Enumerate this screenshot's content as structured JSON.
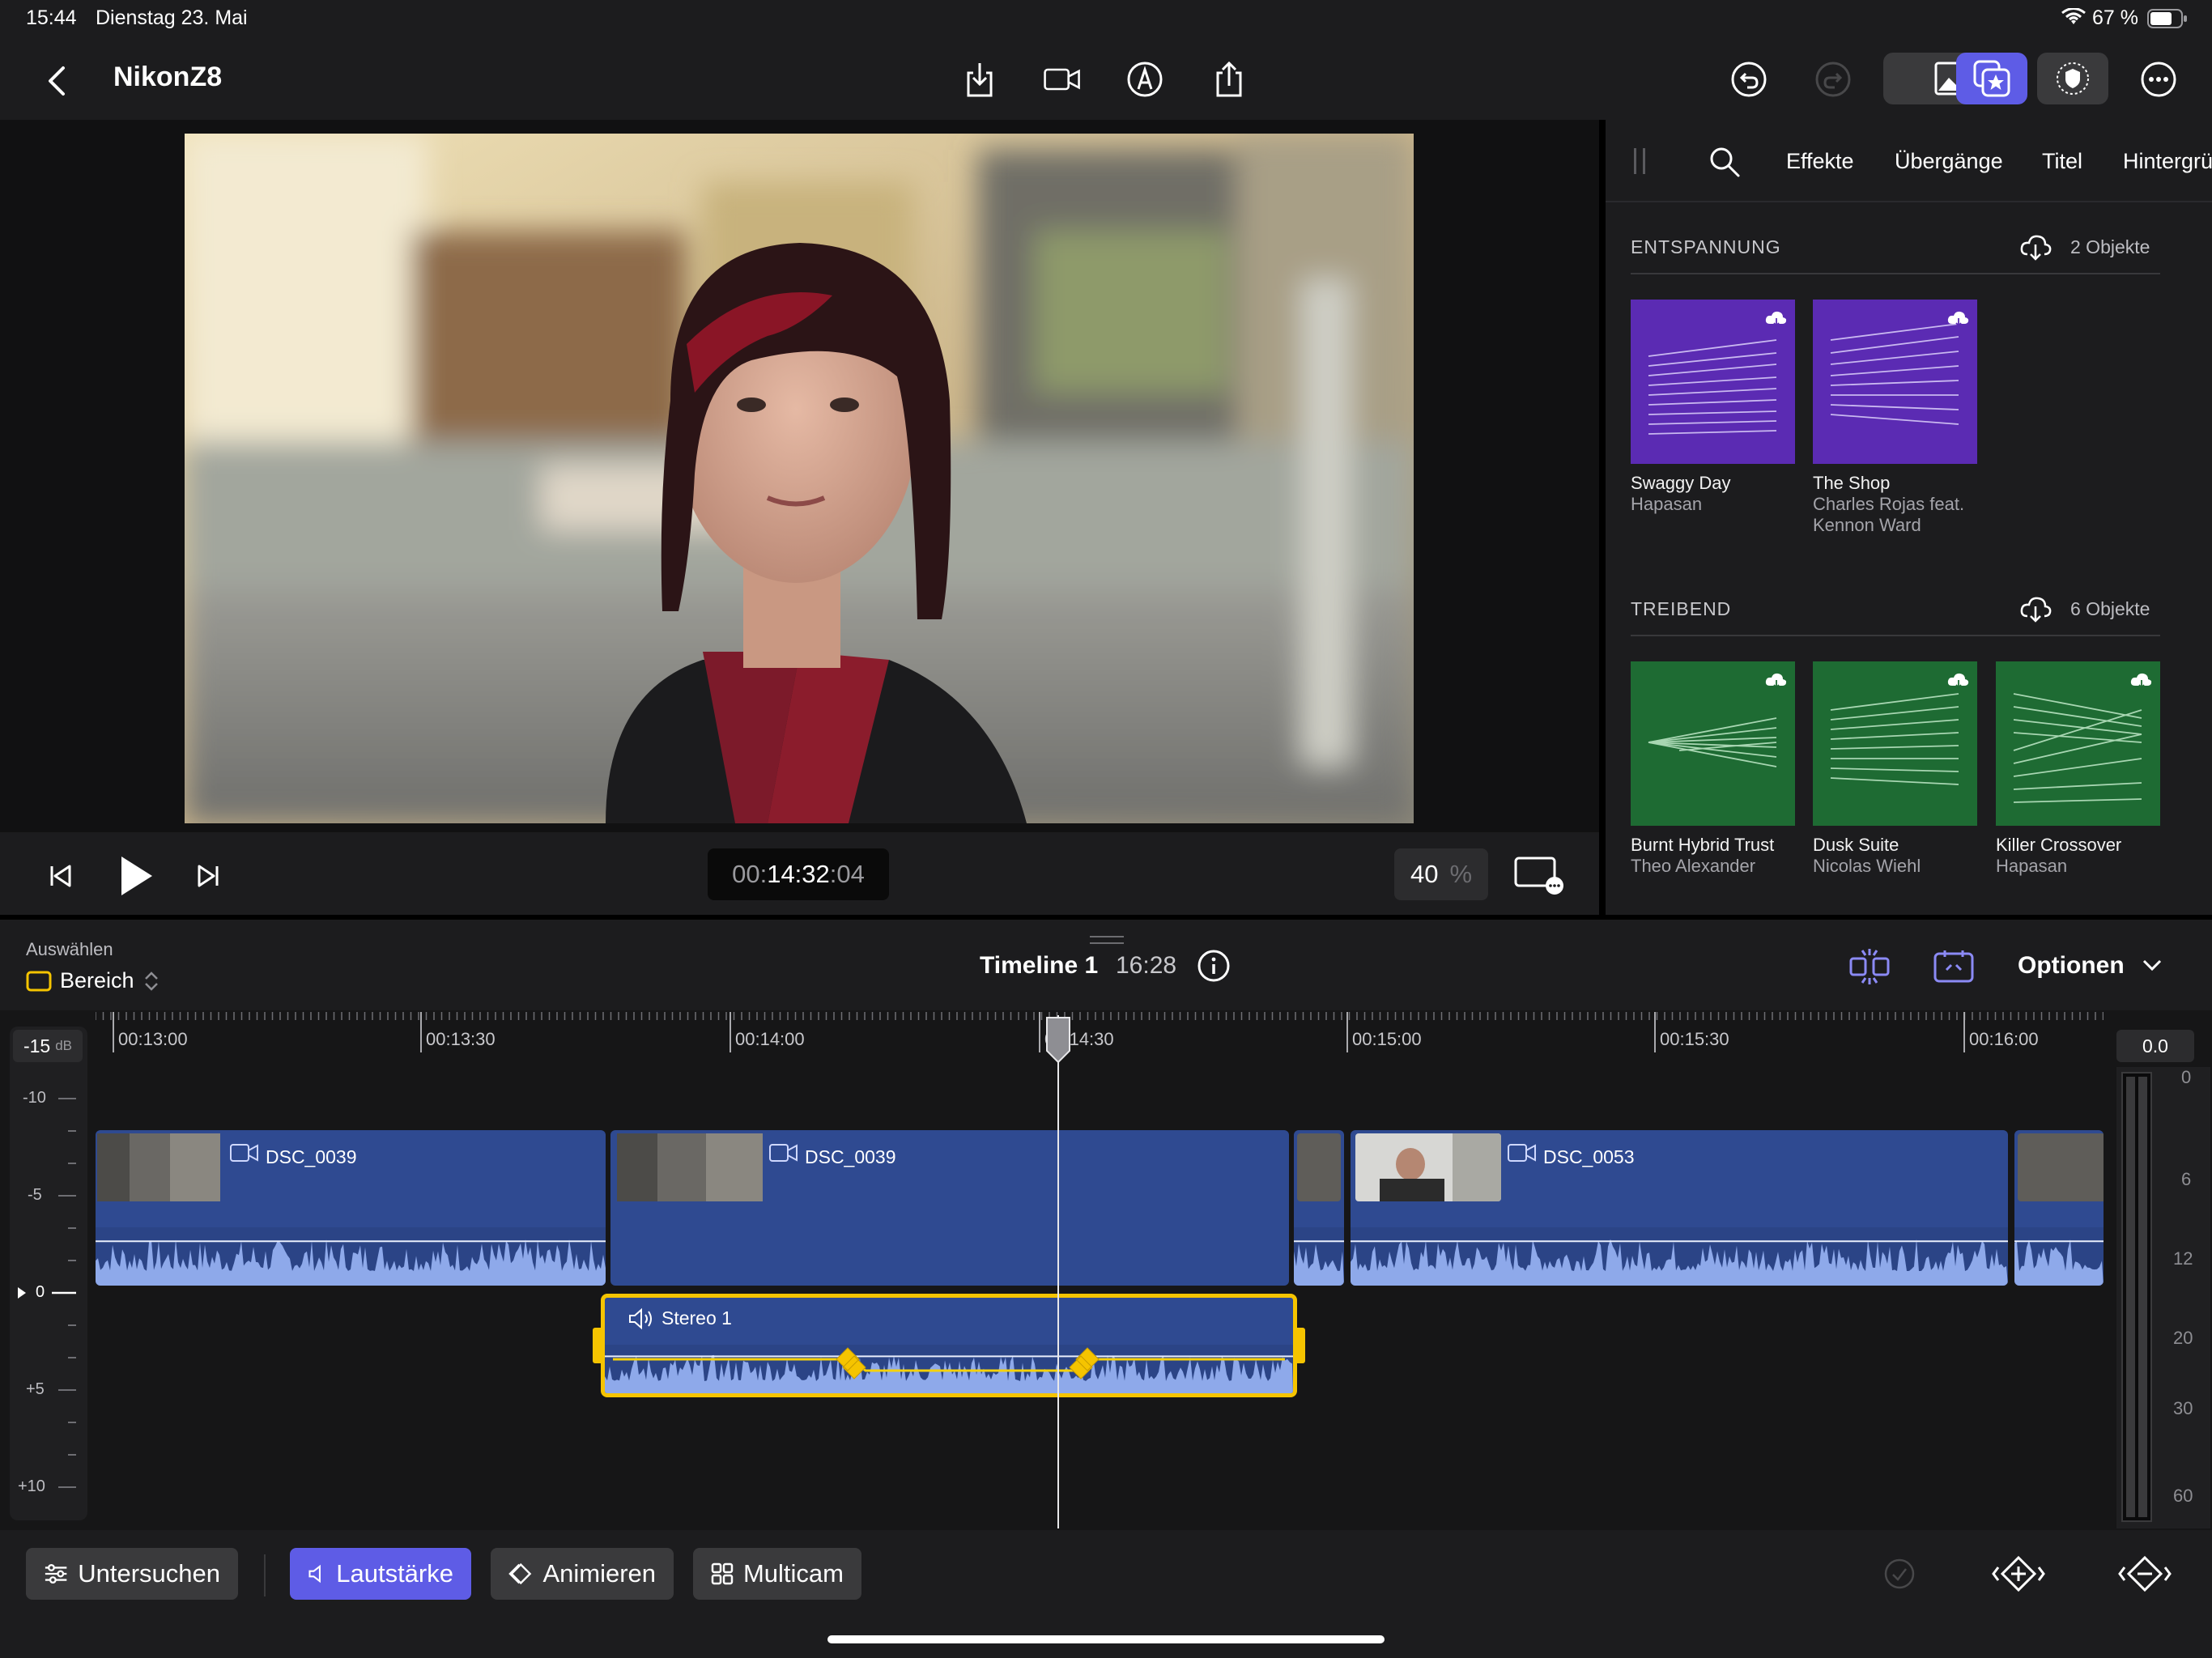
{
  "status_bar": {
    "time": "15:44",
    "date": "Dienstag 23. Mai",
    "battery": "67 %"
  },
  "toolbar": {
    "project_title": "NikonZ8"
  },
  "viewer": {
    "timecode_dim": "00:",
    "timecode_main": "14:32",
    "timecode_frames": ":04",
    "zoom_value": "40",
    "zoom_unit": "%"
  },
  "browser": {
    "tabs": [
      "Effekte",
      "Übergänge",
      "Titel",
      "Hintergrü"
    ],
    "sections": [
      {
        "title": "ENTSPANNUNG",
        "count": "2 Objekte",
        "items": [
          {
            "title": "Swaggy Day",
            "artist": "Hapasan"
          },
          {
            "title": "The Shop",
            "artist": "Charles Rojas feat. Kennon Ward"
          }
        ]
      },
      {
        "title": "TREIBEND",
        "count": "6 Objekte",
        "items": [
          {
            "title": "Burnt Hybrid Trust",
            "artist": "Theo Alexander"
          },
          {
            "title": "Dusk Suite",
            "artist": "Nicolas Wiehl"
          },
          {
            "title": "Killer Crossover",
            "artist": "Hapasan"
          }
        ]
      }
    ]
  },
  "timeline_header": {
    "select_label": "Auswählen",
    "select_value": "Bereich",
    "timeline_name": "Timeline 1",
    "duration": "16:28",
    "options_label": "Optionen"
  },
  "ruler": {
    "ticks": [
      "00:13:00",
      "00:13:30",
      "00:14:00",
      "00:14:30",
      "00:15:00",
      "00:15:30",
      "00:16:00"
    ]
  },
  "db_scale": {
    "current": "-15",
    "unit": "dB",
    "labels": [
      "-10",
      "-5",
      "0",
      "+5",
      "+10"
    ]
  },
  "meter": {
    "value": "0.0",
    "labels": [
      "0",
      "6",
      "12",
      "20",
      "30",
      "60"
    ]
  },
  "clips": {
    "c1": "DSC_0039",
    "c2": "DSC_0039",
    "c3": "DSC_0053",
    "audio": "Stereo 1"
  },
  "bottom_bar": {
    "inspect": "Untersuchen",
    "volume": "Lautstärke",
    "animate": "Animieren",
    "multicam": "Multicam"
  },
  "colors": {
    "accent": "#5e5ce6",
    "clip_blue": "#2f4a91",
    "selection_yellow": "#f5c400",
    "relax_purple": "#5b2bb3",
    "drive_green": "#1e6b33"
  }
}
